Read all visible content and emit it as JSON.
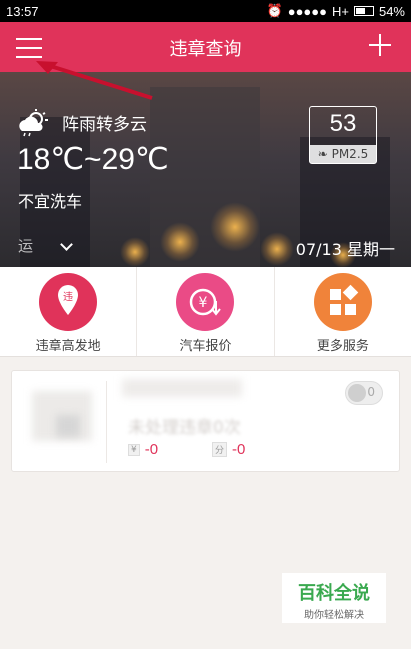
{
  "status_bar": {
    "time": "13:57",
    "network": "H+",
    "battery": "54%"
  },
  "header": {
    "title": "违章查询"
  },
  "weather": {
    "condition": "阵雨转多云",
    "temperature": "18℃~29℃",
    "car_wash": "不宜洗车",
    "aqi_value": "53",
    "aqi_label": "PM2.5",
    "location": "运",
    "date": "07/13 星期一"
  },
  "services": [
    {
      "label": "违章高发地",
      "icon": "violation-pin-icon",
      "color": "#e0335a"
    },
    {
      "label": "汽车报价",
      "icon": "price-yen-icon",
      "color": "#ea4b86"
    },
    {
      "label": "更多服务",
      "icon": "more-grid-icon",
      "color": "#f0833a"
    }
  ],
  "record_card": {
    "violation_text": "未处理违章0次",
    "toggle_count": "0",
    "points_tag": "分",
    "points_value": "-0",
    "fine_tag": "¥",
    "fine_value": "-0"
  },
  "watermark": {
    "title": "百科全说",
    "subtitle": "助你轻松解决"
  },
  "colors": {
    "accent": "#e0335a"
  }
}
